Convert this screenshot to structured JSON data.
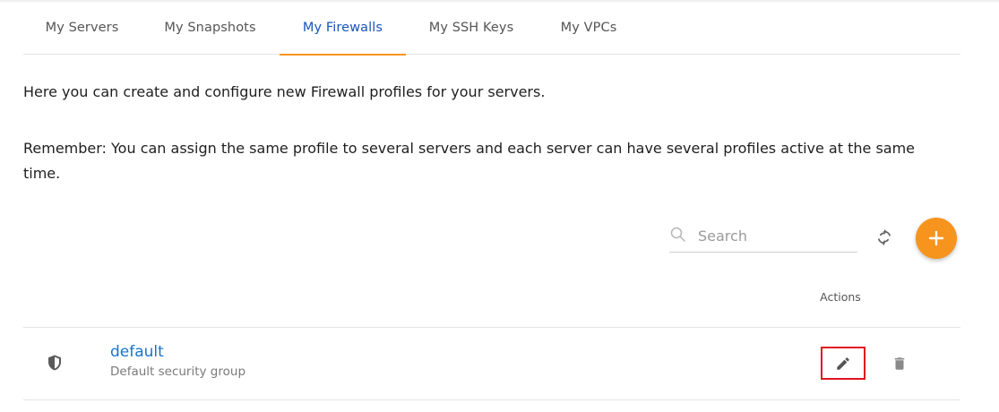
{
  "tabs": [
    {
      "label": "My Servers"
    },
    {
      "label": "My Snapshots"
    },
    {
      "label": "My Firewalls",
      "active": true
    },
    {
      "label": "My SSH Keys"
    },
    {
      "label": "My VPCs"
    }
  ],
  "intro": {
    "line1": "Here you can create and configure new Firewall profiles for your servers.",
    "line2": "Remember: You can assign the same profile to several servers and each server can have several profiles active at the same time."
  },
  "toolbar": {
    "search_placeholder": "Search",
    "refresh_icon": "refresh-icon",
    "add_icon": "plus-icon"
  },
  "table": {
    "actions_header": "Actions",
    "rows": [
      {
        "icon": "shield-icon",
        "name": "default",
        "description": "Default security group",
        "actions": [
          "edit-icon",
          "delete-icon"
        ]
      }
    ]
  },
  "colors": {
    "accent_orange": "#f7941d",
    "link_blue": "#1a73c8",
    "active_tab_blue": "#1a56b8",
    "highlight_red": "#e0141e"
  }
}
